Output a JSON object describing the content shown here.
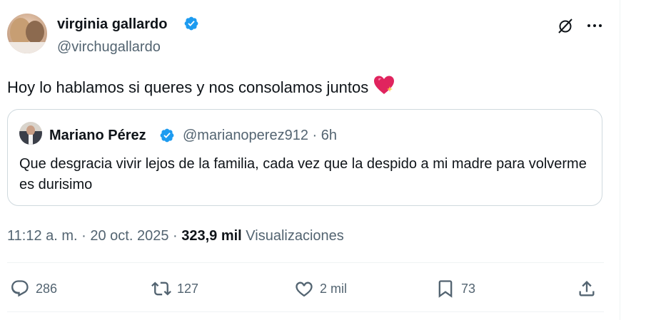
{
  "author": {
    "name": "virginia gallardo",
    "handle": "@virchugallardo",
    "verified": true
  },
  "tweet": {
    "text": "Hoy lo hablamos si queres y nos consolamos juntos",
    "emoji": "sparkling-heart"
  },
  "quote": {
    "name": "Mariano Pérez",
    "handle_time": "@marianoperez912 · 6h",
    "verified": true,
    "text": "Que desgracia vivir lejos de la familia, cada vez que la despido a mi madre para volverme es durisimo"
  },
  "meta": {
    "timestamp": "11:12 a. m. · 20 oct. 2025 · ",
    "views_count": "323,9 mil",
    "views_label": "Visualizaciones"
  },
  "actions": {
    "replies": "286",
    "reposts": "127",
    "likes": "2 mil",
    "bookmarks": "73"
  },
  "icons": [
    "verified-badge-icon",
    "grok-icon",
    "more-icon",
    "reply-icon",
    "repost-icon",
    "like-icon",
    "bookmark-icon",
    "share-icon"
  ],
  "colors": {
    "verified": "#1d9bf0",
    "secondary_text": "#536471",
    "border": "#cfd9de"
  }
}
